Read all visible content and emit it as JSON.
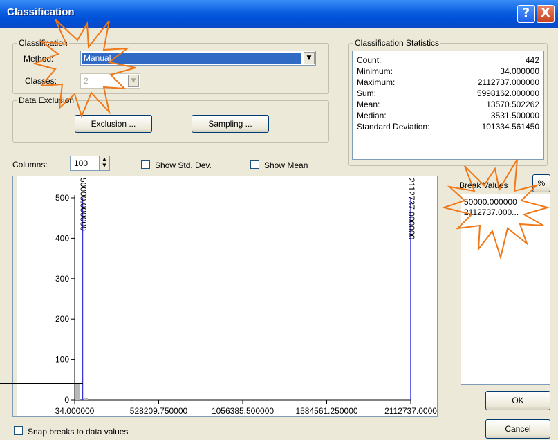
{
  "window": {
    "title": "Classification",
    "help_glyph": "?",
    "close_glyph": "X"
  },
  "classification": {
    "group_label": "Classification",
    "method_label": "Method:",
    "method_value": "Manual",
    "classes_label": "Classes:",
    "classes_value": "2"
  },
  "data_exclusion": {
    "group_label": "Data Exclusion",
    "exclusion_button": "Exclusion ...",
    "sampling_button": "Sampling ..."
  },
  "stats": {
    "group_label": "Classification Statistics",
    "rows": [
      {
        "key": "Count:",
        "value": "442"
      },
      {
        "key": "Minimum:",
        "value": "34.000000"
      },
      {
        "key": "Maximum:",
        "value": "2112737.000000"
      },
      {
        "key": "Sum:",
        "value": "5998162.000000"
      },
      {
        "key": "Mean:",
        "value": "13570.502262"
      },
      {
        "key": "Median:",
        "value": "3531.500000"
      },
      {
        "key": "Standard Deviation:",
        "value": "101334.561450"
      }
    ]
  },
  "columns": {
    "label": "Columns:",
    "value": "100"
  },
  "show_std_dev": {
    "label": "Show Std. Dev.",
    "checked": false
  },
  "show_mean": {
    "label": "Show Mean",
    "checked": false
  },
  "break_values": {
    "label": "Break Values",
    "percent_button": "%",
    "items": [
      "50000.000000",
      "2112737.000..."
    ]
  },
  "chart_data": {
    "type": "bar",
    "y_ticks": [
      "0",
      "100",
      "200",
      "300",
      "400",
      "500"
    ],
    "x_ticks": [
      "34.000000",
      "528209.750000",
      "1056385.500000",
      "1584561.250000",
      "2112737.0000"
    ],
    "xlim": [
      34,
      2112737
    ],
    "ylim": [
      0,
      500
    ],
    "breaks": [
      {
        "value": 50000,
        "label": "50000.000000"
      },
      {
        "value": 2112737,
        "label": "2112737.000000"
      }
    ],
    "histogram": [
      {
        "x": 34,
        "count": 40
      },
      {
        "x": 52000,
        "count": 4
      }
    ],
    "colors": {
      "break_line": "#3535d8",
      "bar": "#b8b8b8"
    }
  },
  "snap": {
    "label": "Snap breaks to data values",
    "checked": false
  },
  "ok_button": "OK",
  "cancel_button": "Cancel",
  "colors": {
    "titlebar": "#0a5ee0",
    "selection": "#316ac5",
    "callout_stroke": "#f07818"
  }
}
